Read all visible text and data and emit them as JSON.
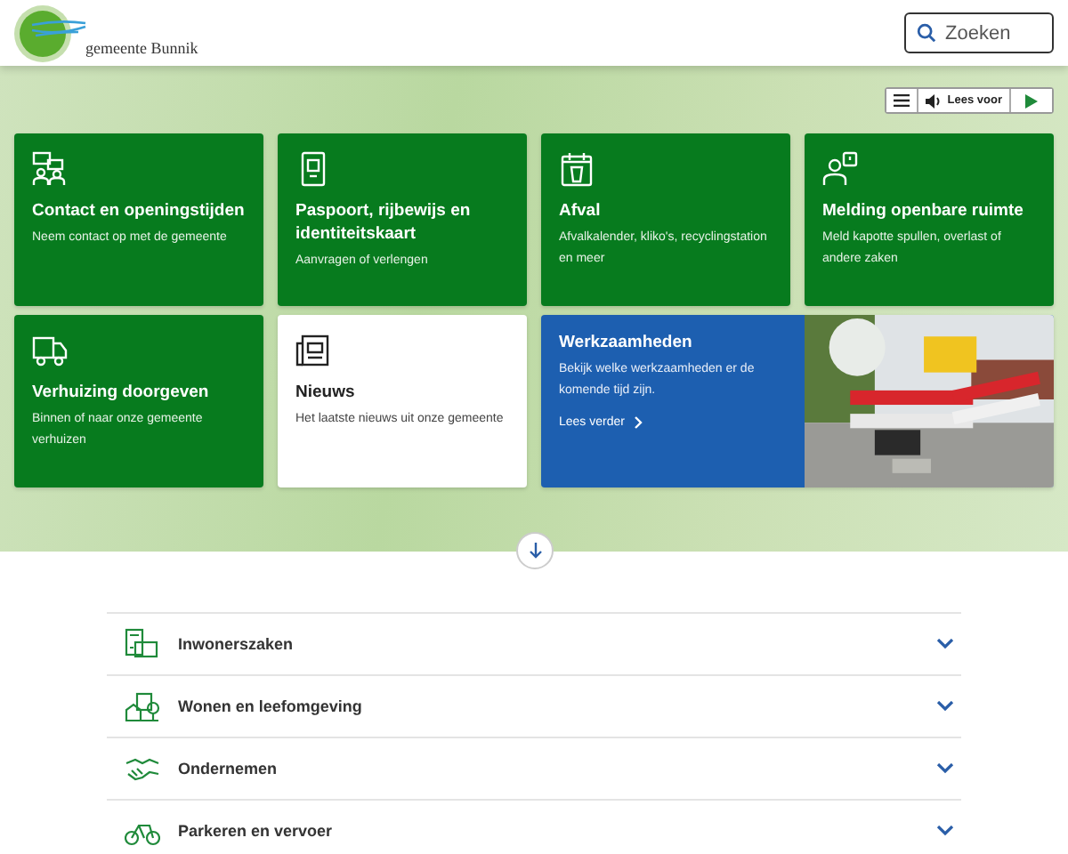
{
  "header": {
    "logo_text": "gemeente Bunnik",
    "search": {
      "placeholder": "Zoeken"
    }
  },
  "read_aloud": {
    "label": "Lees voor"
  },
  "cards": [
    {
      "kind": "green",
      "title": "Contact en openingstijden",
      "text": "Neem contact op met de gemeente"
    },
    {
      "kind": "green",
      "title": "Paspoort, rijbewijs en identiteitskaart",
      "text": "Aanvragen of verlengen"
    },
    {
      "kind": "green",
      "title": "Afval",
      "text": "Afvalkalender, kliko's, recyclingstation en meer"
    },
    {
      "kind": "green",
      "title": "Melding openbare ruimte",
      "text": "Meld kapotte spullen, overlast of andere zaken"
    },
    {
      "kind": "green",
      "title": "Verhuizing doorgeven",
      "text": "Binnen of naar onze gemeente verhuizen"
    },
    {
      "kind": "white",
      "title": "Nieuws",
      "text": "Het laatste nieuws uit onze gemeente"
    },
    {
      "kind": "feature",
      "title": "Werkzaamheden",
      "text": "Bekijk welke werkzaamheden er de komende tijd zijn.",
      "link": "Lees verder"
    }
  ],
  "topics": [
    {
      "label": "Inwonerszaken",
      "expanded": false
    },
    {
      "label": "Wonen en leefomgeving",
      "expanded": false
    },
    {
      "label": "Ondernemen",
      "expanded": false
    },
    {
      "label": "Parkeren en vervoer",
      "expanded": false
    }
  ]
}
